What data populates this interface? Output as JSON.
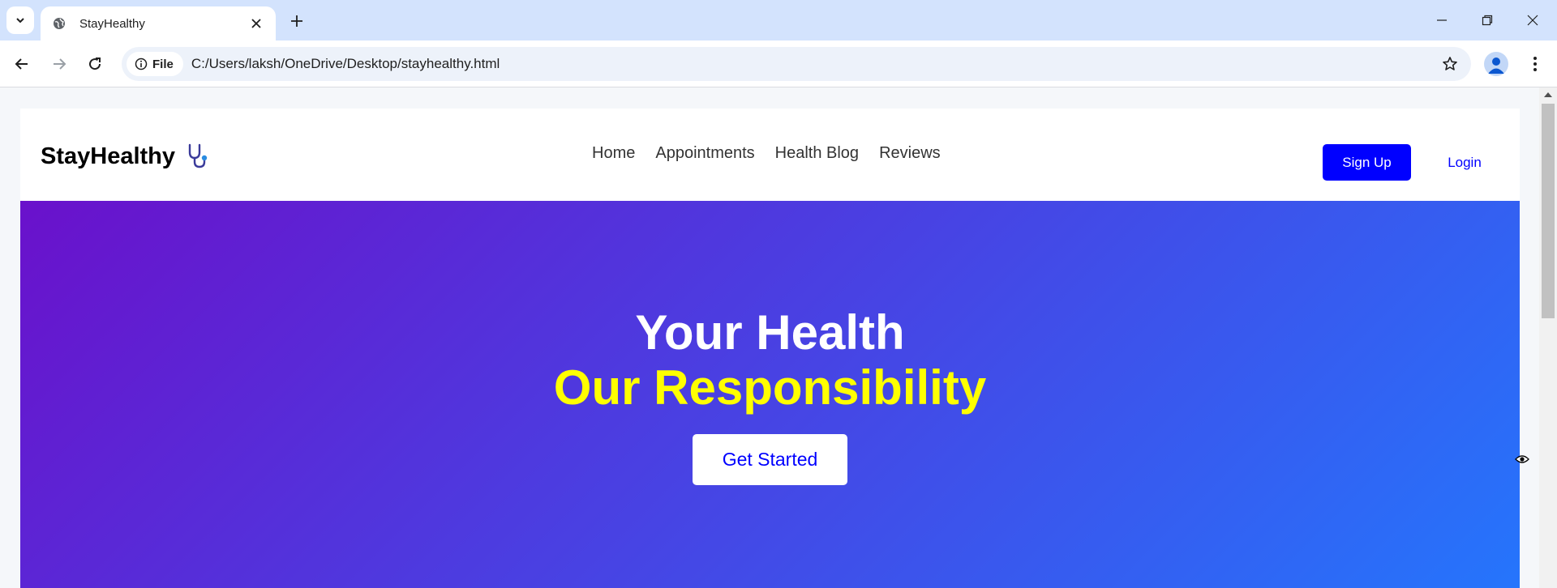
{
  "browser": {
    "tab_title": "StayHealthy",
    "site_chip_label": "File",
    "url": "C:/Users/laksh/OneDrive/Desktop/stayhealthy.html"
  },
  "site": {
    "brand": "StayHealthy",
    "nav": [
      "Home",
      "Appointments",
      "Health Blog",
      "Reviews"
    ],
    "signup_label": "Sign Up",
    "login_label": "Login"
  },
  "hero": {
    "line1": "Your Health",
    "line2": "Our Responsibility",
    "cta_label": "Get Started"
  },
  "colors": {
    "gradient_start": "#6a11cb",
    "gradient_end": "#2575fc",
    "accent_blue": "#0000ff",
    "highlight_yellow": "#ffff00",
    "tabstrip": "#d3e3fd"
  }
}
